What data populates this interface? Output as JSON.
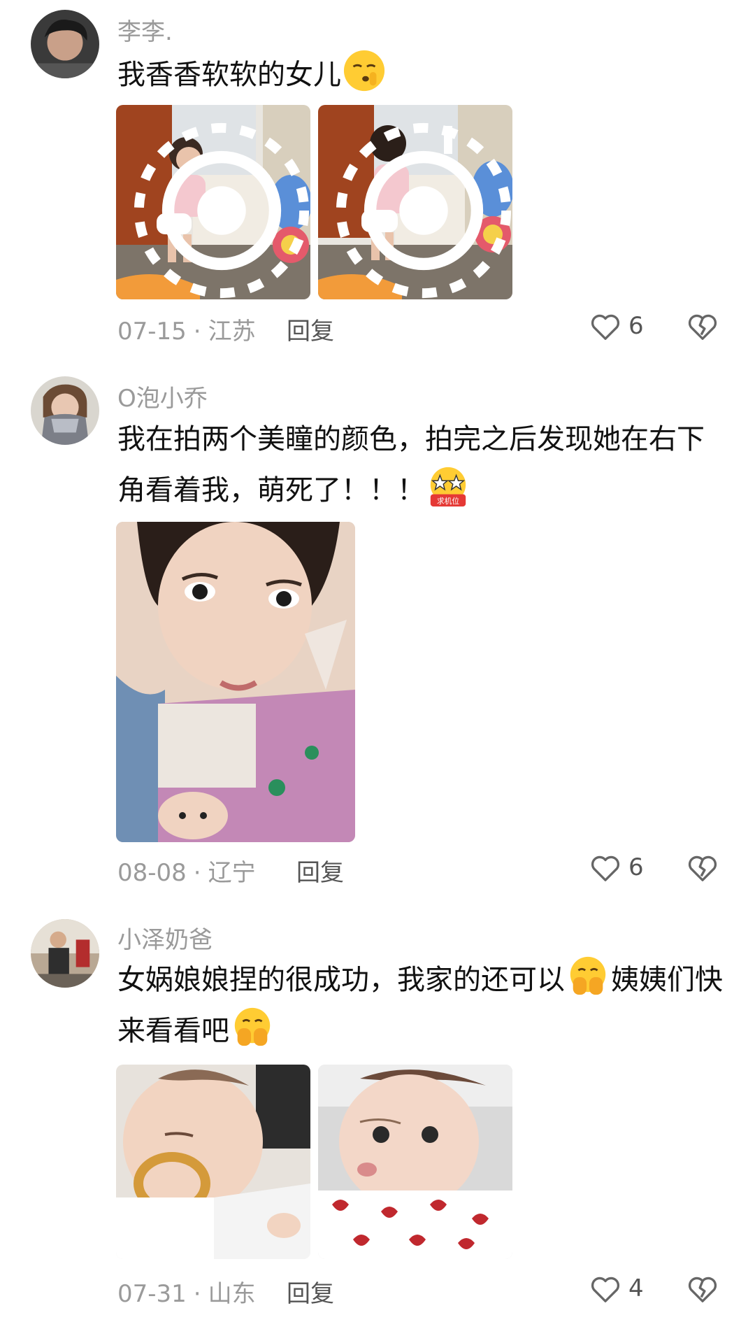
{
  "comments": [
    {
      "username": "李李.",
      "text_parts": [
        "我香香软软的女儿"
      ],
      "emoji": "shush-face",
      "date": "07-15",
      "location": "江苏",
      "reply_label": "回复",
      "likes": "6",
      "photos": [
        "toddler-at-dresser-smiling",
        "toddler-at-dresser-back"
      ]
    },
    {
      "username": "O泡小乔",
      "text_parts": [
        "我在拍两个美瞳的颜色，拍完之后发现她在右下角看着我，萌死了！！！"
      ],
      "emoji": "star-eyes-camera",
      "emoji_label": "求机位",
      "date": "08-08",
      "location": "辽宁",
      "reply_label": "回复",
      "likes": "6",
      "photos": [
        "selfie-with-baby"
      ]
    },
    {
      "username": "小泽奶爸",
      "text_parts": [
        "女娲娘娘捏的很成功，我家的还可以",
        "姨姨们快来看看吧"
      ],
      "emoji": "hands-over-mouth",
      "date": "07-31",
      "location": "山东",
      "reply_label": "回复",
      "likes": "4",
      "photos": [
        "baby-with-pacifier",
        "baby-heart-outfit"
      ]
    }
  ],
  "icons": {
    "like": "heart-outline-icon",
    "dislike": "broken-heart-icon",
    "live": "live-photo-icon"
  },
  "colors": {
    "meta_text": "#9a9a9a",
    "body_text": "#111111",
    "emoji_yellow": "#ffcc33"
  }
}
